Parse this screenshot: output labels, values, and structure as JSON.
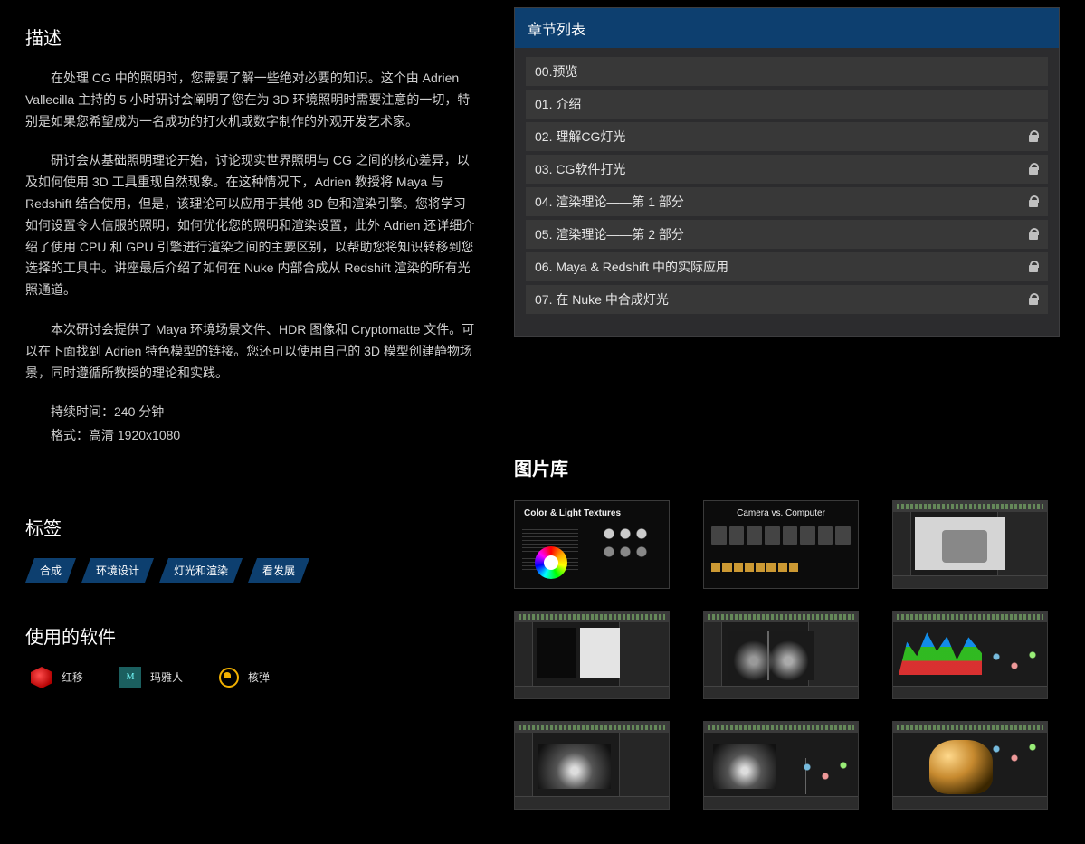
{
  "description": {
    "title": "描述",
    "paragraphs": [
      "在处理 CG 中的照明时，您需要了解一些绝对必要的知识。这个由 Adrien Vallecilla 主持的 5 小时研讨会阐明了您在为 3D 环境照明时需要注意的一切，特别是如果您希望成为一名成功的打火机或数字制作的外观开发艺术家。",
      "研讨会从基础照明理论开始，讨论现实世界照明与 CG 之间的核心差异，以及如何使用 3D 工具重现自然现象。在这种情况下，Adrien 教授将 Maya 与 Redshift 结合使用，但是，该理论可以应用于其他 3D 包和渲染引擎。您将学习如何设置令人信服的照明，如何优化您的照明和渲染设置，此外 Adrien 还详细介绍了使用 CPU 和 GPU 引擎进行渲染之间的主要区别，以帮助您将知识转移到您选择的工具中。讲座最后介绍了如何在 Nuke 内部合成从 Redshift 渲染的所有光照通道。",
      "本次研讨会提供了 Maya 环境场景文件、HDR 图像和 Cryptomatte 文件。可以在下面找到 Adrien 特色模型的链接。您还可以使用自己的 3D 模型创建静物场景，同时遵循所教授的理论和实践。"
    ],
    "duration_label": "持续时间：240 分钟",
    "format_label": "格式：高清 1920x1080"
  },
  "tags": {
    "title": "标签",
    "items": [
      "合成",
      "环境设计",
      "灯光和渲染",
      "看发展"
    ]
  },
  "software": {
    "title": "使用的软件",
    "items": [
      {
        "icon": "redshift",
        "label": "红移"
      },
      {
        "icon": "maya",
        "label": "玛雅人"
      },
      {
        "icon": "nuke",
        "label": "核弹"
      }
    ]
  },
  "chapters": {
    "title": "章节列表",
    "items": [
      {
        "label": "00.预览",
        "locked": false
      },
      {
        "label": "01. 介绍",
        "locked": false
      },
      {
        "label": "02. 理解CG灯光",
        "locked": true
      },
      {
        "label": "03. CG软件打光",
        "locked": true
      },
      {
        "label": "04. 渲染理论——第 1 部分",
        "locked": true
      },
      {
        "label": "05. 渲染理论——第 2 部分",
        "locked": true
      },
      {
        "label": "06. Maya & Redshift 中的实际应用",
        "locked": true
      },
      {
        "label": "07. 在 Nuke 中合成灯光",
        "locked": true
      }
    ]
  },
  "gallery": {
    "title": "图片库",
    "thumbs": [
      {
        "caption": "Color & Light Textures"
      },
      {
        "caption": "Camera vs. Computer"
      },
      {
        "caption": ""
      },
      {
        "caption": ""
      },
      {
        "caption": ""
      },
      {
        "caption": ""
      },
      {
        "caption": ""
      },
      {
        "caption": ""
      },
      {
        "caption": ""
      }
    ]
  }
}
